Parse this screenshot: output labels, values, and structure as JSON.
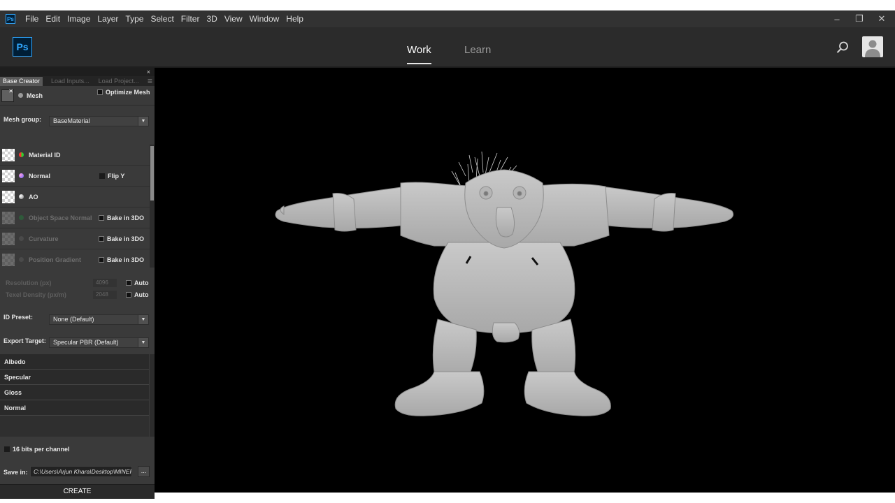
{
  "menubar": {
    "app_icon": "Ps",
    "items": [
      "File",
      "Edit",
      "Image",
      "Layer",
      "Type",
      "Select",
      "Filter",
      "3D",
      "View",
      "Window",
      "Help"
    ],
    "window_controls": {
      "minimize": "–",
      "restore": "❐",
      "close": "✕"
    }
  },
  "header": {
    "logo": "Ps",
    "tabs": [
      {
        "label": "Work",
        "active": true
      },
      {
        "label": "Learn",
        "active": false
      }
    ],
    "icons": [
      "search-icon",
      "user-avatar-icon"
    ]
  },
  "panel": {
    "close": "×",
    "tabs": [
      "Base Creator",
      "Load Inputs...",
      "Load Project..."
    ],
    "mesh": {
      "label": "Mesh",
      "optimize_label": "Optimize Mesh"
    },
    "mesh_group": {
      "label": "Mesh group:",
      "value": "BaseMaterial"
    },
    "maps": [
      {
        "label": "Material ID",
        "enabled": true,
        "option": ""
      },
      {
        "label": "Normal",
        "enabled": true,
        "option": "Flip Y"
      },
      {
        "label": "AO",
        "enabled": true,
        "option": ""
      },
      {
        "label": "Object Space Normal",
        "enabled": false,
        "option": "Bake in 3DO"
      },
      {
        "label": "Curvature",
        "enabled": false,
        "option": "Bake in 3DO"
      },
      {
        "label": "Position Gradient",
        "enabled": false,
        "option": "Bake in 3DO"
      }
    ],
    "resolution": {
      "label": "Resolution (px)",
      "value": "4096",
      "auto_label": "Auto"
    },
    "texel_density": {
      "label": "Texel Density (px/m)",
      "value": "2048",
      "auto_label": "Auto"
    },
    "id_preset": {
      "label": "ID Preset:",
      "value": "None (Default)"
    },
    "export_target": {
      "label": "Export Target:",
      "value": "Specular PBR (Default)"
    },
    "outputs": [
      "Albedo",
      "Specular",
      "Gloss",
      "Normal"
    ],
    "bits": {
      "label": "16 bits per channel"
    },
    "save_in": {
      "label": "Save in:",
      "value": "C:\\Users\\Arjun Khara\\Desktop\\MINER",
      "browse_label": "..."
    },
    "create_label": "CREATE"
  },
  "viewport": {
    "content": "3d-character-model"
  },
  "colors": {
    "accent": "#31a8ff",
    "menubar": "#323232",
    "panel": "#3a3a3a",
    "viewport": "#000000"
  }
}
